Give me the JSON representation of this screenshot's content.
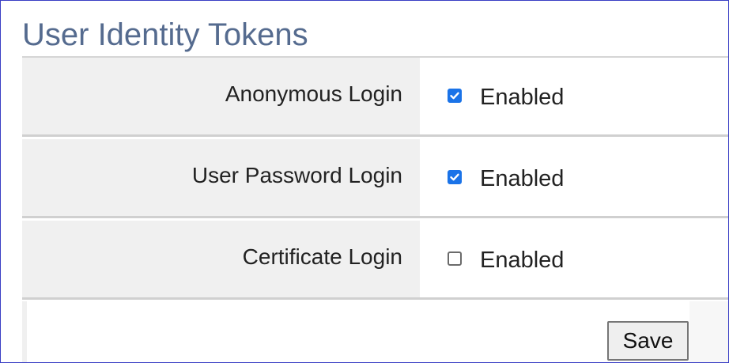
{
  "section": {
    "title": "User Identity Tokens"
  },
  "rows": [
    {
      "label": "Anonymous Login",
      "option_label": "Enabled",
      "checked": true
    },
    {
      "label": "User Password Login",
      "option_label": "Enabled",
      "checked": true
    },
    {
      "label": "Certificate Login",
      "option_label": "Enabled",
      "checked": false
    }
  ],
  "actions": {
    "save_label": "Save"
  },
  "colors": {
    "title": "#556b8f",
    "checkbox_checked": "#1a73e8",
    "label_cell_bg": "#f0f0f0",
    "frame_border": "#3a3fc4"
  }
}
